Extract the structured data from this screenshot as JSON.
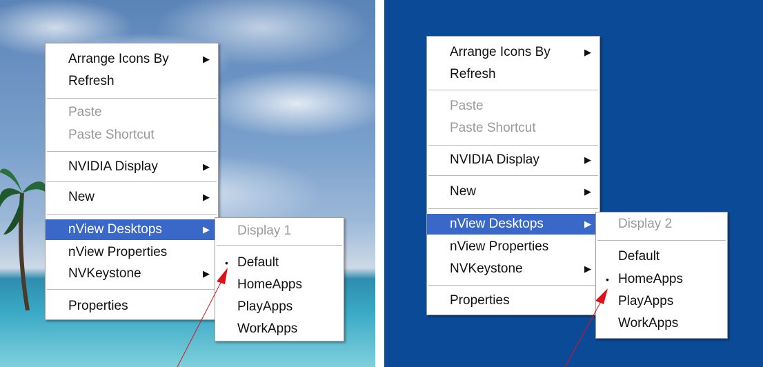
{
  "left": {
    "context_menu": {
      "items": [
        {
          "label": "Arrange Icons By",
          "submenu": true,
          "disabled": false
        },
        {
          "label": "Refresh",
          "submenu": false,
          "disabled": false
        },
        {
          "label": "Paste",
          "submenu": false,
          "disabled": true
        },
        {
          "label": "Paste Shortcut",
          "submenu": false,
          "disabled": true
        },
        {
          "label": "NVIDIA Display",
          "submenu": true,
          "disabled": false
        },
        {
          "label": "New",
          "submenu": true,
          "disabled": false
        },
        {
          "label": "nView Desktops",
          "submenu": true,
          "disabled": false,
          "highlighted": true
        },
        {
          "label": "nView Properties",
          "submenu": false,
          "disabled": false
        },
        {
          "label": "NVKeystone",
          "submenu": true,
          "disabled": false
        },
        {
          "label": "Properties",
          "submenu": false,
          "disabled": false
        }
      ]
    },
    "submenu": {
      "header": "Display 1",
      "items": [
        {
          "label": "Default",
          "selected": true
        },
        {
          "label": "HomeApps",
          "selected": false
        },
        {
          "label": "PlayApps",
          "selected": false
        },
        {
          "label": "WorkApps",
          "selected": false
        }
      ]
    }
  },
  "right": {
    "context_menu": {
      "items": [
        {
          "label": "Arrange Icons By",
          "submenu": true,
          "disabled": false
        },
        {
          "label": "Refresh",
          "submenu": false,
          "disabled": false
        },
        {
          "label": "Paste",
          "submenu": false,
          "disabled": true
        },
        {
          "label": "Paste Shortcut",
          "submenu": false,
          "disabled": true
        },
        {
          "label": "NVIDIA Display",
          "submenu": true,
          "disabled": false
        },
        {
          "label": "New",
          "submenu": true,
          "disabled": false
        },
        {
          "label": "nView Desktops",
          "submenu": true,
          "disabled": false,
          "highlighted": true
        },
        {
          "label": "nView Properties",
          "submenu": false,
          "disabled": false
        },
        {
          "label": "NVKeystone",
          "submenu": true,
          "disabled": false
        },
        {
          "label": "Properties",
          "submenu": false,
          "disabled": false
        }
      ]
    },
    "submenu": {
      "header": "Display 2",
      "items": [
        {
          "label": "Default",
          "selected": false
        },
        {
          "label": "HomeApps",
          "selected": true
        },
        {
          "label": "PlayApps",
          "selected": false
        },
        {
          "label": "WorkApps",
          "selected": false
        }
      ]
    }
  },
  "icons": {
    "submenu_arrow": "▶",
    "bullet": "•"
  },
  "colors": {
    "highlight": "#3a68c8",
    "desktop_blue": "#0b4a97",
    "annotation_arrow": "#e0101a"
  }
}
